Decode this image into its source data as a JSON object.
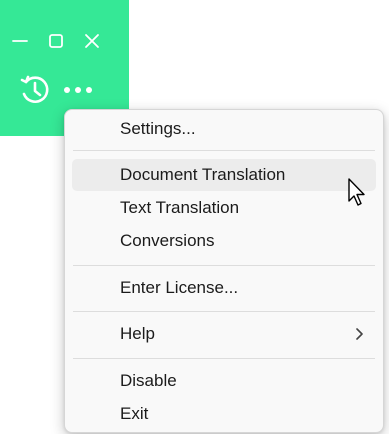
{
  "app": {
    "accent_color": "#35e896"
  },
  "title_bar": {
    "controls": [
      {
        "name": "minimize",
        "icon": "minimize-icon"
      },
      {
        "name": "maximize",
        "icon": "maximize-icon"
      },
      {
        "name": "close",
        "icon": "close-icon"
      }
    ]
  },
  "toolbar": {
    "buttons": [
      {
        "name": "history",
        "icon": "history-icon"
      },
      {
        "name": "more",
        "icon": "more-icon"
      }
    ]
  },
  "context_menu": {
    "items": [
      {
        "label": "Settings...",
        "highlighted": false,
        "submenu": false
      },
      {
        "label": "Document Translation",
        "highlighted": true,
        "submenu": false
      },
      {
        "label": "Text Translation",
        "highlighted": false,
        "submenu": false
      },
      {
        "label": "Conversions",
        "highlighted": false,
        "submenu": false
      },
      {
        "label": "Enter License...",
        "highlighted": false,
        "submenu": false
      },
      {
        "label": "Help",
        "highlighted": false,
        "submenu": true
      },
      {
        "label": "Disable",
        "highlighted": false,
        "submenu": false
      },
      {
        "label": "Exit",
        "highlighted": false,
        "submenu": false
      }
    ]
  },
  "cursor": {
    "icon": "mouse-pointer-icon"
  }
}
